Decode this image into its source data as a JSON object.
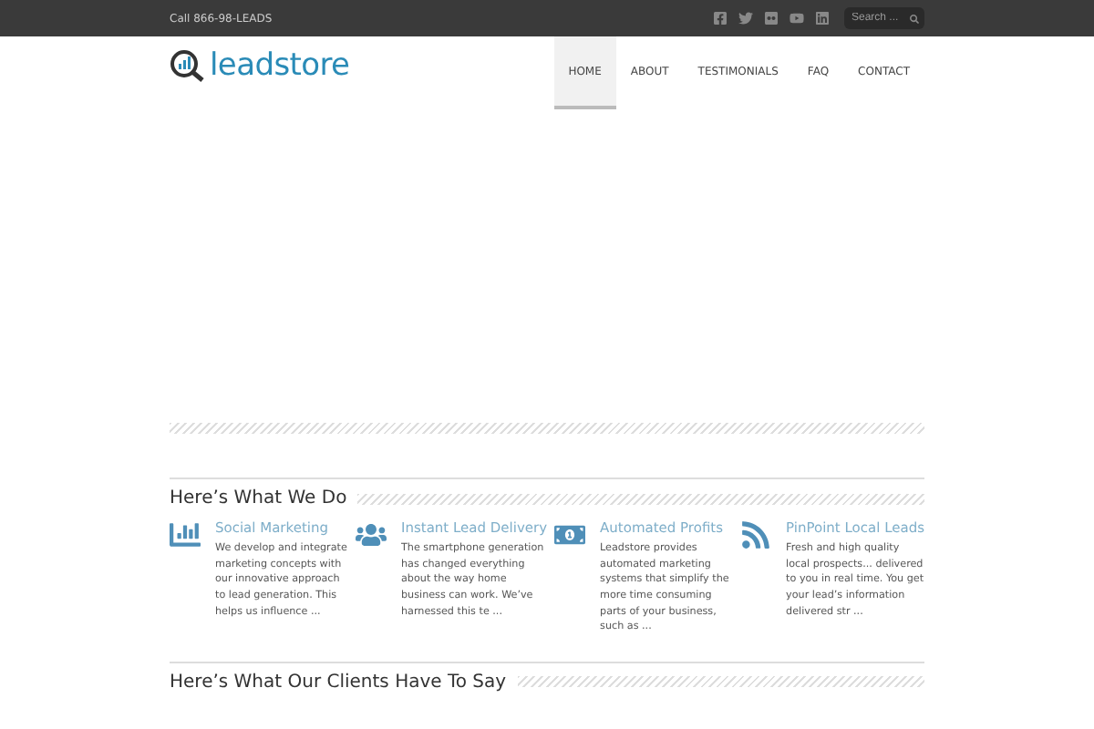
{
  "top_bar": {
    "phone": "Call 866-98-LEADS",
    "search": {
      "placeholder": "Search ..."
    }
  },
  "logo": {
    "text": "leadstore"
  },
  "nav": [
    {
      "label": "HOME",
      "selected": true
    },
    {
      "label": "ABOUT",
      "selected": false
    },
    {
      "label": "TESTIMONIALS",
      "selected": false
    },
    {
      "label": "FAQ",
      "selected": false
    },
    {
      "label": "CONTACT",
      "selected": false
    }
  ],
  "services": {
    "heading": "Here’s What We Do",
    "items": [
      {
        "kind": "chart",
        "title": "Social Marketing",
        "text": "We develop and integrate marketing concepts with our innovative approach to lead generation. This helps us influence ..."
      },
      {
        "kind": "people",
        "title": "Instant Lead Delivery",
        "text": "The smartphone generation has changed everything about the way home business can work. We’ve harnessed this te ..."
      },
      {
        "kind": "money",
        "title": "Automated Profits",
        "text": "Leadstore provides automated marketing systems that simplify the more time consuming parts of your business, such as ..."
      },
      {
        "kind": "feed",
        "title": "PinPoint Local Leads",
        "text": "Fresh and high quality local prospects... delivered to you in real time. You get your lead’s information delivered str ..."
      }
    ]
  },
  "testimonials": {
    "heading": "Here’s What Our Clients Have To Say"
  }
}
